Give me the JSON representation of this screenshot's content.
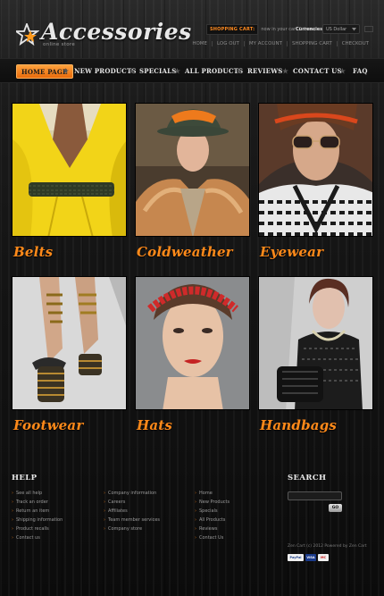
{
  "header": {
    "logo_text": "Accessories",
    "logo_sub": "online store",
    "cart_label": "SHOPPING CART:",
    "cart_status": "now in your cart 0 items",
    "currencies_label": "Currencies:",
    "currency_selected": "US Dollar",
    "top_links": [
      "HOME",
      "LOG OUT",
      "MY ACCOUNT",
      "SHOPPING CART",
      "CHECKOUT"
    ]
  },
  "nav": {
    "items": [
      "HOME PAGE",
      "NEW PRODUCTS",
      "SPECIALS",
      "ALL PRODUCTS",
      "REVIEWS",
      "CONTACT US",
      "FAQ"
    ],
    "active_index": 0
  },
  "categories": [
    "Belts",
    "Coldweather",
    "Eyewear",
    "Footwear",
    "Hats",
    "Handbags"
  ],
  "footer": {
    "help_title": "HELP",
    "col1": [
      "See all help",
      "Track an order",
      "Return an item",
      "Shipping information",
      "Product recalls",
      "Contact us"
    ],
    "col2": [
      "Company information",
      "Careers",
      "Affiliates",
      "Team member services",
      "Company store"
    ],
    "col3": [
      "Home",
      "New Products",
      "Specials",
      "All Products",
      "Reviews",
      "Contact Us"
    ],
    "search_title": "SEARCH",
    "search_button": "GO",
    "copyright": "Zen Cart (c) 2012  Powered by Zen Cart",
    "payment_labels": [
      "PayPal",
      "VISA",
      "MC"
    ]
  },
  "colors": {
    "accent": "#ff8a1a",
    "nav_active": "#f58a24",
    "background": "#111111"
  }
}
